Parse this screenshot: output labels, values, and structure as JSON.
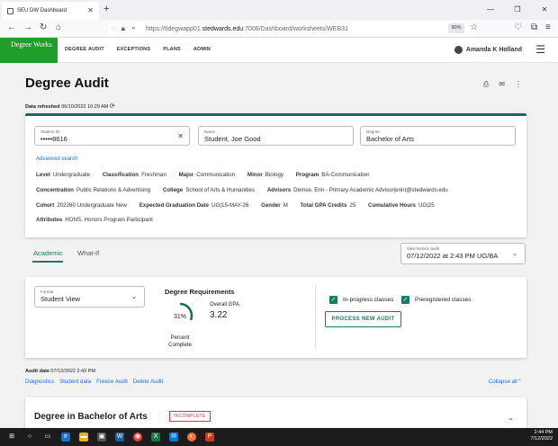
{
  "browser": {
    "tab_title": "SEU DW Dashboard",
    "url_prefix": "https://tldegwapp01.",
    "url_domain": "stedwards.edu",
    "url_suffix": ":7008/Dashboard/worksheets/WEB31",
    "zoom": "90%"
  },
  "header": {
    "logo": "Degree Works",
    "menu": [
      "DEGREE AUDIT",
      "EXCEPTIONS",
      "PLANS",
      "ADMIN"
    ],
    "user": "Amanda K Holland"
  },
  "page": {
    "title": "Degree Audit",
    "refreshed_label": "Data refreshed",
    "refreshed_value": "06/10/2022 10:29 AM"
  },
  "student": {
    "id_label": "Student ID",
    "id_value": "•••••8616",
    "name_label": "Name",
    "name_value": "Student, Joe Good",
    "degree_label": "Degree",
    "degree_value": "Bachelor of Arts",
    "advanced_search": "Advanced search",
    "rows": [
      [
        [
          "Level",
          "Undergraduate"
        ],
        [
          "Classification",
          "Freshman"
        ],
        [
          "Major",
          "Communication"
        ],
        [
          "Minor",
          "Biology"
        ],
        [
          "Program",
          "BA-Communication"
        ]
      ],
      [
        [
          "Concentration",
          "Public Relations & Advertising"
        ],
        [
          "College",
          "School of Arts & Humanities"
        ],
        [
          "Advisors",
          "Demse, Erin - Primary Academic Advisor|erint@stedwards.edu"
        ]
      ],
      [
        [
          "Cohort",
          "202260 Undergraduate New"
        ],
        [
          "Expected Graduation Date",
          "UG|15-MAY-26"
        ],
        [
          "Gender",
          "M"
        ],
        [
          "Total GPA Credits",
          "25"
        ],
        [
          "Cumulative Hours",
          "UG|25"
        ]
      ],
      [
        [
          "Attributes",
          "HONS, Honors Program Participant"
        ]
      ]
    ]
  },
  "tabs": {
    "academic": "Academic",
    "whatif": "What-If"
  },
  "history": {
    "label": "View historic audit",
    "value": "07/12/2022 at 2:43 PM UG/BA"
  },
  "requirements": {
    "format_label": "Format",
    "format_value": "Student View",
    "title": "Degree Requirements",
    "percent": 31,
    "percent_text": "31%",
    "percent_label": "Percent Complete",
    "gpa_label": "Overall GPA",
    "gpa_value": "3.22",
    "inprogress_label": "In-progress classes",
    "prereg_label": "Preregistered classes",
    "process_button": "PROCESS NEW AUDIT"
  },
  "audit": {
    "date_label": "Audit date",
    "date_value": "07/12/2022 2:43 PM",
    "links": [
      "Diagnostics",
      "Student data",
      "Freeze Audit",
      "Delete Audit"
    ],
    "collapse": "Collapse all"
  },
  "degree_block": {
    "title": "Degree in Bachelor of Arts",
    "status": "INCOMPLETE"
  },
  "taskbar": {
    "time": "2:44 PM",
    "date": "7/12/2022"
  },
  "colors": {
    "brand_green": "#1f9e29",
    "accent_teal": "#1a7a66",
    "link_blue": "#1d6fd6",
    "incomplete_red": "#dd3333"
  }
}
